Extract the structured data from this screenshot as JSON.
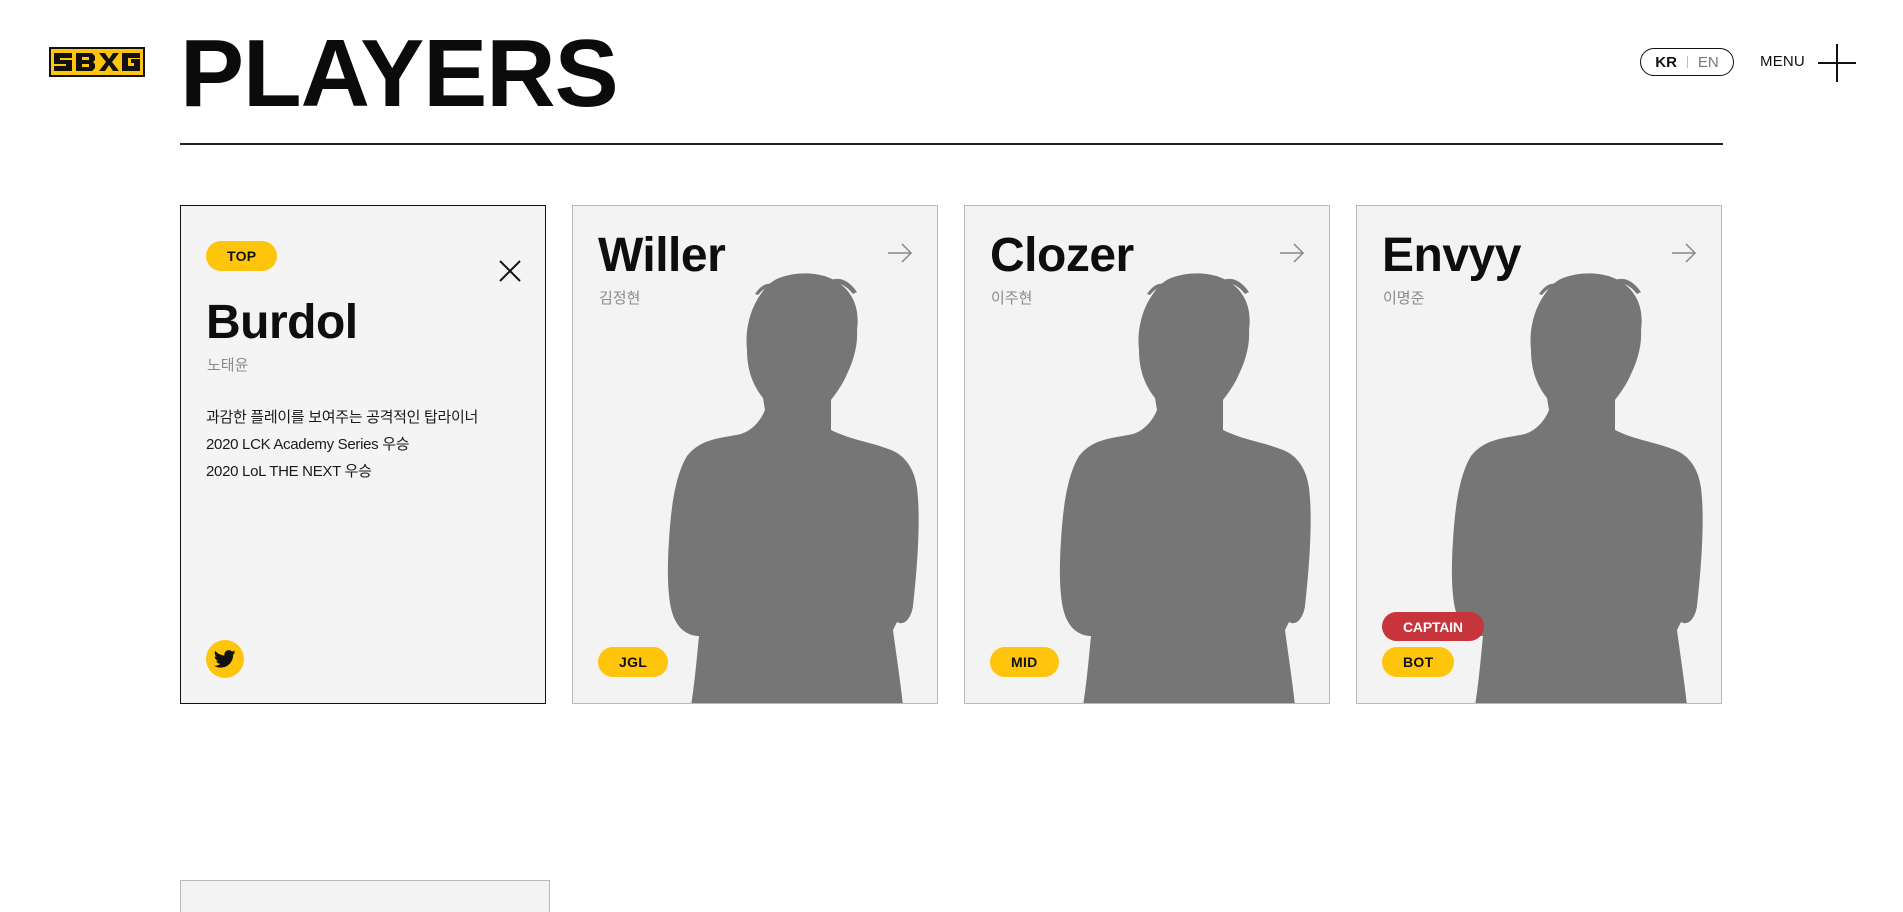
{
  "header": {
    "logo_text": "SBXG",
    "page_title": "PLAYERS",
    "lang": {
      "kr": "KR",
      "en": "EN"
    },
    "menu_label": "MENU",
    "brand_color": "#ffc40c"
  },
  "players": [
    {
      "name": "Burdol",
      "realname": "노태윤",
      "position": "TOP",
      "expanded": true,
      "bio": [
        "과감한 플레이를 보여주는 공격적인 탑라이너",
        "2020 LCK Academy Series 우승",
        "2020 LoL THE NEXT 우승"
      ]
    },
    {
      "name": "Willer",
      "realname": "김정현",
      "position": "JGL"
    },
    {
      "name": "Clozer",
      "realname": "이주현",
      "position": "MID"
    },
    {
      "name": "Envyy",
      "realname": "이명준",
      "position": "BOT",
      "captain_label": "CAPTAIN"
    }
  ],
  "colors": {
    "badge": "#ffc40c",
    "captain": "#c8343c",
    "card_bg": "#f3f3f3",
    "silhouette": "#767676"
  }
}
